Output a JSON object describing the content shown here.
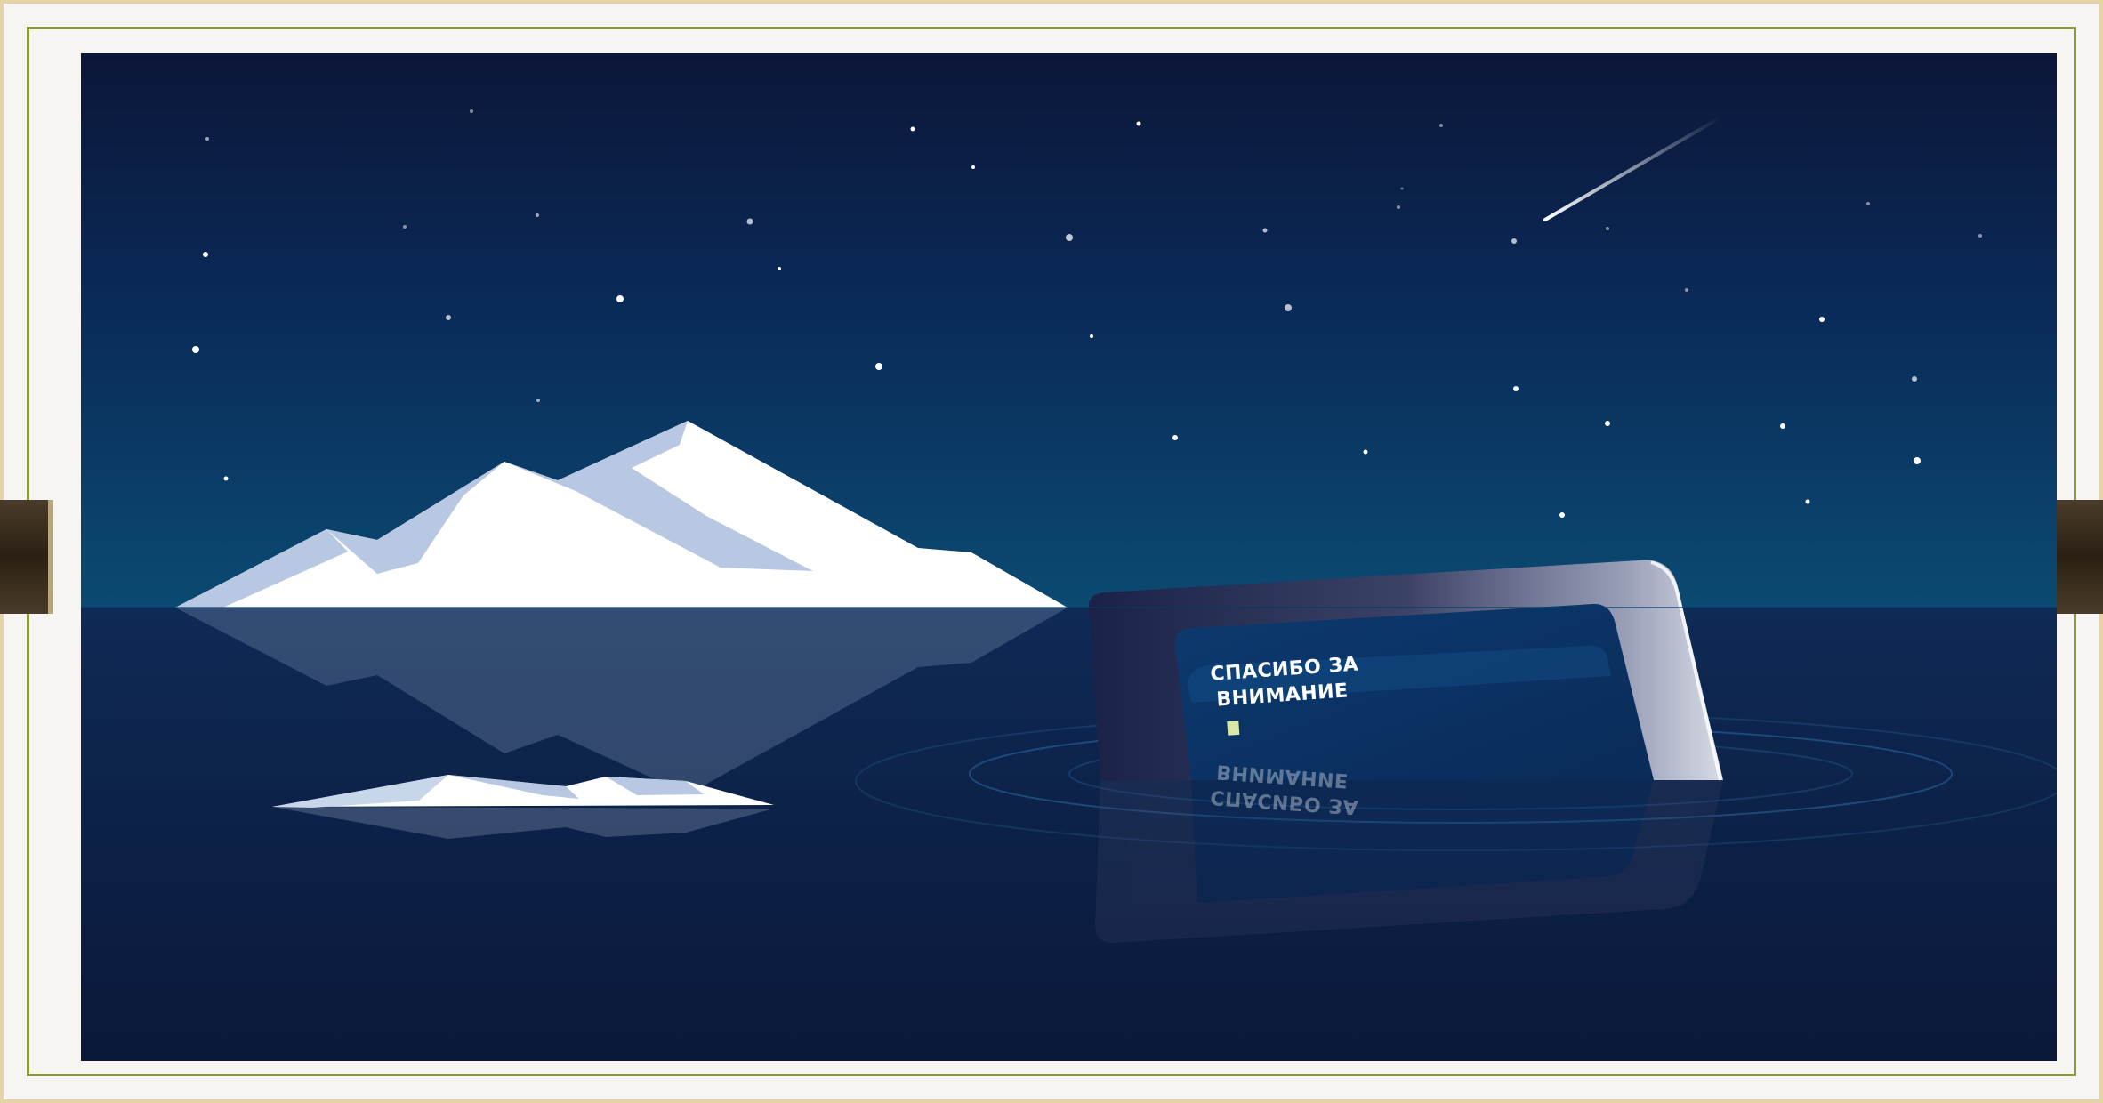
{
  "slide": {
    "message_line1": "СПАСИБО ЗА",
    "message_line2": "ВНИМАНИЕ"
  },
  "colors": {
    "sky_top": "#0c1638",
    "sky_horizon": "#0b4a72",
    "water": "#0d2450",
    "iceberg_light": "#ffffff",
    "iceberg_shade": "#b8c8e2",
    "frame_accent": "#8a9a3a",
    "frame_outer": "#e6d4a8"
  }
}
